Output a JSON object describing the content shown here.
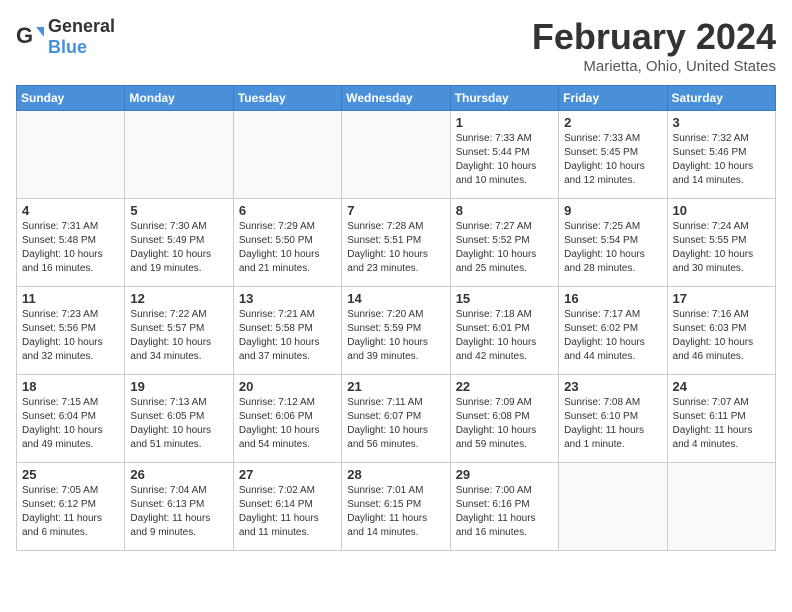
{
  "logo": {
    "general": "General",
    "blue": "Blue"
  },
  "header": {
    "month": "February 2024",
    "location": "Marietta, Ohio, United States"
  },
  "weekdays": [
    "Sunday",
    "Monday",
    "Tuesday",
    "Wednesday",
    "Thursday",
    "Friday",
    "Saturday"
  ],
  "weeks": [
    [
      {
        "day": "",
        "info": ""
      },
      {
        "day": "",
        "info": ""
      },
      {
        "day": "",
        "info": ""
      },
      {
        "day": "",
        "info": ""
      },
      {
        "day": "1",
        "info": "Sunrise: 7:33 AM\nSunset: 5:44 PM\nDaylight: 10 hours\nand 10 minutes."
      },
      {
        "day": "2",
        "info": "Sunrise: 7:33 AM\nSunset: 5:45 PM\nDaylight: 10 hours\nand 12 minutes."
      },
      {
        "day": "3",
        "info": "Sunrise: 7:32 AM\nSunset: 5:46 PM\nDaylight: 10 hours\nand 14 minutes."
      }
    ],
    [
      {
        "day": "4",
        "info": "Sunrise: 7:31 AM\nSunset: 5:48 PM\nDaylight: 10 hours\nand 16 minutes."
      },
      {
        "day": "5",
        "info": "Sunrise: 7:30 AM\nSunset: 5:49 PM\nDaylight: 10 hours\nand 19 minutes."
      },
      {
        "day": "6",
        "info": "Sunrise: 7:29 AM\nSunset: 5:50 PM\nDaylight: 10 hours\nand 21 minutes."
      },
      {
        "day": "7",
        "info": "Sunrise: 7:28 AM\nSunset: 5:51 PM\nDaylight: 10 hours\nand 23 minutes."
      },
      {
        "day": "8",
        "info": "Sunrise: 7:27 AM\nSunset: 5:52 PM\nDaylight: 10 hours\nand 25 minutes."
      },
      {
        "day": "9",
        "info": "Sunrise: 7:25 AM\nSunset: 5:54 PM\nDaylight: 10 hours\nand 28 minutes."
      },
      {
        "day": "10",
        "info": "Sunrise: 7:24 AM\nSunset: 5:55 PM\nDaylight: 10 hours\nand 30 minutes."
      }
    ],
    [
      {
        "day": "11",
        "info": "Sunrise: 7:23 AM\nSunset: 5:56 PM\nDaylight: 10 hours\nand 32 minutes."
      },
      {
        "day": "12",
        "info": "Sunrise: 7:22 AM\nSunset: 5:57 PM\nDaylight: 10 hours\nand 34 minutes."
      },
      {
        "day": "13",
        "info": "Sunrise: 7:21 AM\nSunset: 5:58 PM\nDaylight: 10 hours\nand 37 minutes."
      },
      {
        "day": "14",
        "info": "Sunrise: 7:20 AM\nSunset: 5:59 PM\nDaylight: 10 hours\nand 39 minutes."
      },
      {
        "day": "15",
        "info": "Sunrise: 7:18 AM\nSunset: 6:01 PM\nDaylight: 10 hours\nand 42 minutes."
      },
      {
        "day": "16",
        "info": "Sunrise: 7:17 AM\nSunset: 6:02 PM\nDaylight: 10 hours\nand 44 minutes."
      },
      {
        "day": "17",
        "info": "Sunrise: 7:16 AM\nSunset: 6:03 PM\nDaylight: 10 hours\nand 46 minutes."
      }
    ],
    [
      {
        "day": "18",
        "info": "Sunrise: 7:15 AM\nSunset: 6:04 PM\nDaylight: 10 hours\nand 49 minutes."
      },
      {
        "day": "19",
        "info": "Sunrise: 7:13 AM\nSunset: 6:05 PM\nDaylight: 10 hours\nand 51 minutes."
      },
      {
        "day": "20",
        "info": "Sunrise: 7:12 AM\nSunset: 6:06 PM\nDaylight: 10 hours\nand 54 minutes."
      },
      {
        "day": "21",
        "info": "Sunrise: 7:11 AM\nSunset: 6:07 PM\nDaylight: 10 hours\nand 56 minutes."
      },
      {
        "day": "22",
        "info": "Sunrise: 7:09 AM\nSunset: 6:08 PM\nDaylight: 10 hours\nand 59 minutes."
      },
      {
        "day": "23",
        "info": "Sunrise: 7:08 AM\nSunset: 6:10 PM\nDaylight: 11 hours\nand 1 minute."
      },
      {
        "day": "24",
        "info": "Sunrise: 7:07 AM\nSunset: 6:11 PM\nDaylight: 11 hours\nand 4 minutes."
      }
    ],
    [
      {
        "day": "25",
        "info": "Sunrise: 7:05 AM\nSunset: 6:12 PM\nDaylight: 11 hours\nand 6 minutes."
      },
      {
        "day": "26",
        "info": "Sunrise: 7:04 AM\nSunset: 6:13 PM\nDaylight: 11 hours\nand 9 minutes."
      },
      {
        "day": "27",
        "info": "Sunrise: 7:02 AM\nSunset: 6:14 PM\nDaylight: 11 hours\nand 11 minutes."
      },
      {
        "day": "28",
        "info": "Sunrise: 7:01 AM\nSunset: 6:15 PM\nDaylight: 11 hours\nand 14 minutes."
      },
      {
        "day": "29",
        "info": "Sunrise: 7:00 AM\nSunset: 6:16 PM\nDaylight: 11 hours\nand 16 minutes."
      },
      {
        "day": "",
        "info": ""
      },
      {
        "day": "",
        "info": ""
      }
    ]
  ]
}
